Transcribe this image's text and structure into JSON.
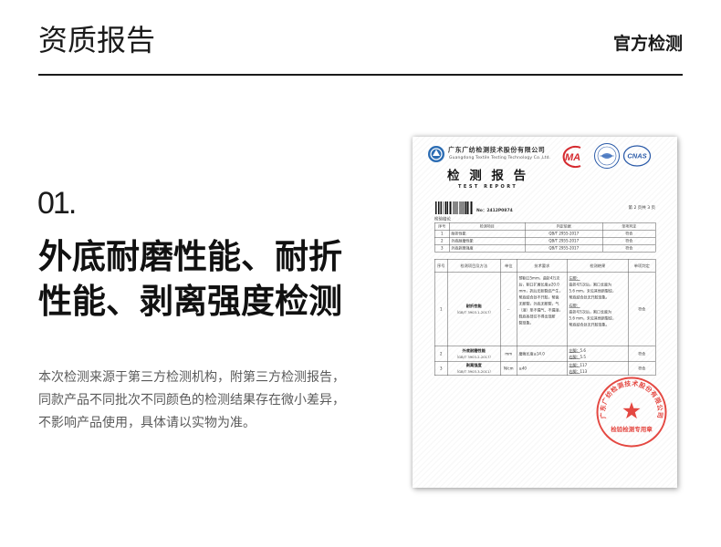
{
  "header": {
    "title": "资质报告",
    "tag": "官方检测"
  },
  "section": {
    "index": "01.",
    "heading_lines": [
      "外底耐磨性能、耐折",
      "性能、剥离强度检测"
    ],
    "description_lines": [
      "本次检测来源于第三方检测机构，附第三方检测报告，",
      "同款产品不同批次不同颜色的检测结果存在微小差异，",
      "不影响产品使用，具体请以实物为准。"
    ]
  },
  "report": {
    "company_cn": "广东广纺检测技术股份有限公司",
    "company_en": "Guangdong Textile Testing Technology Co.,Ltd.",
    "logos": {
      "cma": "MA",
      "cnas": "CNAS"
    },
    "title_cn": "检 测 报 告",
    "title_en": "TEST REPORT",
    "report_no": "No：2412P0874",
    "page": "第 2 页共 3 页",
    "summary": {
      "label": "检验结论",
      "headers": [
        "序号",
        "检测项目",
        "判定依据",
        "单项判定"
      ],
      "rows": [
        [
          "1",
          "耐折性能",
          "QB/T 2955-2017",
          "符合"
        ],
        [
          "2",
          "外底耐磨性能",
          "QB/T 2955-2017",
          "符合"
        ],
        [
          "3",
          "外底剥离强度",
          "QB/T 2955-2017",
          "符合"
        ]
      ]
    },
    "detail": {
      "headers": [
        "序号",
        "检测项目及方法",
        "单位",
        "技术要求",
        "检测结果",
        "单项判定"
      ],
      "rows": [
        {
          "no": "1",
          "item": "耐折性能",
          "method": "（GB/T 3903.1-2017）",
          "unit": "--",
          "requirement_lines": [
            "预割口5mm，曲折4万次",
            "后，割口扩展长度≤20.0",
            "mm，折后无新裂纹产生，",
            "帮底结合处不开胶，帮面",
            "无断裂，外底无断裂，气",
            "（液）垫不漏气、不漏液，",
            "鞋底各部位不得出现断",
            "裂现象。"
          ],
          "results": [
            {
              "label": "左脚：",
              "lines": [
                "曲折4万次后，割口长度为",
                "5.6 mm，未见其他新裂纹，",
                "帮底结合处无开胶现象。"
              ]
            },
            {
              "label": "右脚：",
              "lines": [
                "曲折4万次后，割口长度为",
                "5.6 mm，未见其他新裂纹，",
                "帮底结合处无开胶现象。"
              ]
            }
          ],
          "verdict": "符合"
        },
        {
          "no": "2",
          "item": "外底耐磨性能",
          "method": "（GB/T 3903.2-2017）",
          "unit": "mm",
          "requirement": "磨痕长度≤14.0",
          "results": [
            {
              "label": "左脚：",
              "value": "5.6"
            },
            {
              "label": "右脚：",
              "value": "5.5"
            }
          ],
          "verdict": "符合"
        },
        {
          "no": "3",
          "item": "剥离强度",
          "method": "（GB/T 3903.3-2011）",
          "unit": "N/cm",
          "requirement": "≥40",
          "results": [
            {
              "label": "左脚：",
              "value": "117"
            },
            {
              "label": "右脚：",
              "value": "113"
            }
          ],
          "verdict": "符合"
        }
      ]
    },
    "stamp": {
      "ring_text": "广东广纺检测技术股份有限公司",
      "center_text": "检验检测专用章"
    }
  }
}
